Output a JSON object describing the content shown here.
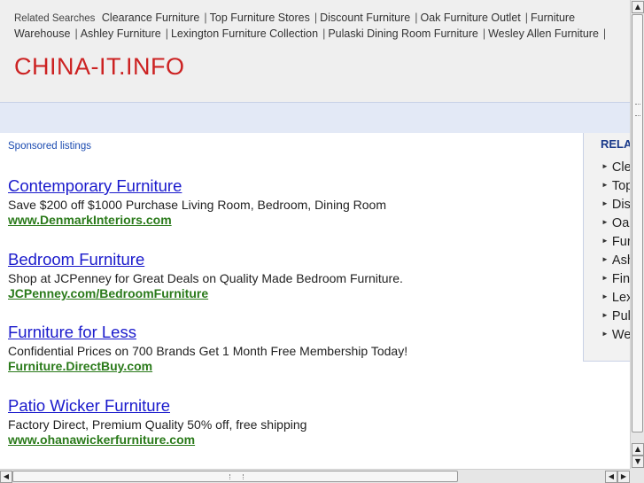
{
  "header": {
    "related_label": "Related Searches",
    "related_links": [
      "Clearance Furniture",
      "Top Furniture Stores",
      "Discount Furniture",
      "Oak Furniture Outlet",
      "Furniture Warehouse",
      "Ashley Furniture",
      "Lexington Furniture Collection",
      "Pulaski Dining Room Furniture",
      "Wesley Allen Furniture"
    ],
    "separator": "|",
    "site_title": "CHINA-IT.INFO"
  },
  "sponsored": {
    "label": "Sponsored listings",
    "ads": [
      {
        "title": "Contemporary Furniture",
        "desc": "Save $200 off $1000 Purchase Living Room, Bedroom, Dining Room",
        "url": "www.DenmarkInteriors.com"
      },
      {
        "title": "Bedroom Furniture",
        "desc": "Shop at JCPenney for Great Deals on Quality Made Bedroom Furniture.",
        "url": "JCPenney.com/BedroomFurniture"
      },
      {
        "title": "Furniture for Less",
        "desc": "Confidential Prices on 700 Brands Get 1 Month Free Membership Today!",
        "url": "Furniture.DirectBuy.com"
      },
      {
        "title": "Patio Wicker Furniture",
        "desc": "Factory Direct, Premium Quality 50% off, free shipping",
        "url": "www.ohanawickerfurniture.com"
      }
    ]
  },
  "right_panel": {
    "title": "RELAT",
    "items": [
      "Cle",
      "Top",
      "Dis",
      "Oak",
      "Fur",
      "Ash",
      "Fin",
      "Lex",
      "Pul",
      "We"
    ]
  },
  "scrollbars": {
    "up_arrow": "▲",
    "down_arrow": "▼",
    "left_arrow": "◀",
    "right_arrow": "▶"
  }
}
